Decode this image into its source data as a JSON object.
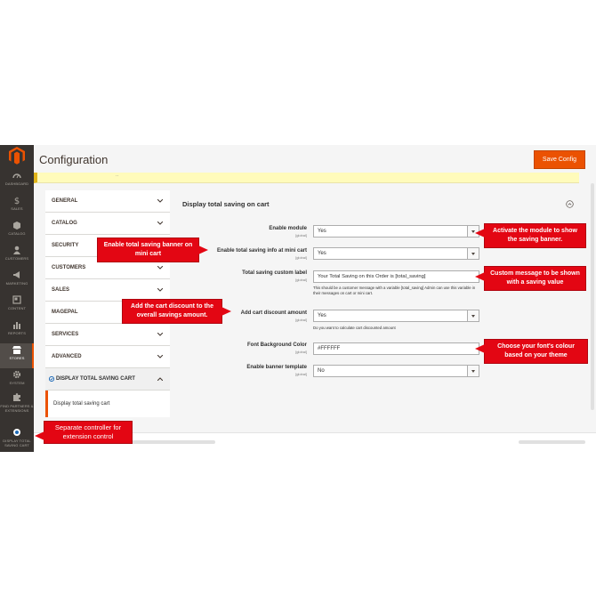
{
  "colors": {
    "accent": "#eb5202",
    "sidebar": "#373330",
    "callout": "#e30613"
  },
  "header": {
    "title": "Configuration",
    "save_label": "Save Config"
  },
  "sidebar": {
    "items": [
      {
        "label": "DASHBOARD",
        "icon": "dashboard-icon"
      },
      {
        "label": "SALES",
        "icon": "dollar-icon"
      },
      {
        "label": "CATALOG",
        "icon": "box-icon"
      },
      {
        "label": "CUSTOMERS",
        "icon": "person-icon"
      },
      {
        "label": "MARKETING",
        "icon": "megaphone-icon"
      },
      {
        "label": "CONTENT",
        "icon": "content-icon"
      },
      {
        "label": "REPORTS",
        "icon": "bar-chart-icon"
      },
      {
        "label": "STORES",
        "icon": "store-icon"
      },
      {
        "label": "SYSTEM",
        "icon": "gear-icon"
      },
      {
        "label": "FIND PARTNERS & EXTENSIONS",
        "icon": "puzzle-icon"
      },
      {
        "label": "DISPLAY TOTAL SAVING CART",
        "icon": "magpal-icon"
      }
    ]
  },
  "tabs": [
    {
      "label": "GENERAL"
    },
    {
      "label": "CATALOG"
    },
    {
      "label": "SECURITY"
    },
    {
      "label": "CUSTOMERS"
    },
    {
      "label": "SALES"
    },
    {
      "label": "MAGEPAL"
    },
    {
      "label": "SERVICES"
    },
    {
      "label": "ADVANCED"
    },
    {
      "label": "DISPLAY TOTAL SAVING CART",
      "sub": "Display total saving cart"
    }
  ],
  "section": {
    "title": "Display total saving on cart",
    "rows": [
      {
        "label": "Enable module",
        "scope": "[global]",
        "value": "Yes"
      },
      {
        "label": "Enable total saving info at mini cart",
        "scope": "[global]",
        "value": "Yes"
      },
      {
        "label": "Total saving custom label",
        "scope": "[global]",
        "value": "Your Total Saving on this Order is [total_saving]",
        "note": "This should be a customer message with a variable [total_saving] Admin can use this variable in their messages on cart or mini cart."
      },
      {
        "label": "Add cart discount amount",
        "scope": "[global]",
        "value": "Yes",
        "note": "Do you want to calculate cart discounted amount"
      },
      {
        "label": "Font Background Color",
        "scope": "[global]",
        "value": "#FFFFFF"
      },
      {
        "label": "Enable banner template",
        "scope": "[global]",
        "value": "No"
      }
    ]
  },
  "callouts": {
    "activate": "Activate the module to show the saving banner.",
    "mini_cart": "Enable total saving banner on mini cart",
    "custom_message": "Custom message to be shown with a saving value",
    "discount": "Add the cart discount to the overall savings amount.",
    "font_colour": "Choose your font's colour based on your theme",
    "controller": "Separate controller for extension control"
  }
}
